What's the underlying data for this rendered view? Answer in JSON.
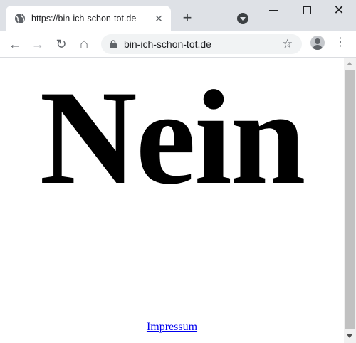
{
  "browser": {
    "tab": {
      "title": "https://bin-ich-schon-tot.de",
      "close_glyph": "✕",
      "favicon_icon": "globe-icon"
    },
    "new_tab_glyph": "+",
    "window_controls": {
      "close_glyph": "✕"
    },
    "toolbar": {
      "back_glyph": "←",
      "forward_glyph": "→",
      "reload_glyph": "↻",
      "home_glyph": "⌂",
      "url": "bin-ich-schon-tot.de",
      "bookmark_glyph": "☆",
      "menu_glyph": "⋮"
    }
  },
  "page": {
    "headline": "Nein",
    "footer_link": "Impressum"
  },
  "colors": {
    "link": "#0000ee",
    "tabstrip": "#dee1e6",
    "omnibox": "#f1f3f4"
  }
}
